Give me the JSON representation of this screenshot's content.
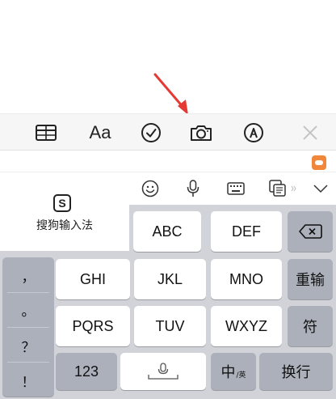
{
  "toolbar": {
    "text_style_label": "Aa",
    "buttons": [
      "table-icon",
      "text-style",
      "checklist-icon",
      "camera-icon",
      "markup-icon",
      "close-icon"
    ]
  },
  "ime": {
    "name": "搜狗输入法",
    "logo_letter": "S",
    "toolbar_icons": [
      "emoji-icon",
      "microphone-icon",
      "keyboard-icon",
      "translate-icon",
      "chevron-down-icon"
    ]
  },
  "keyboard": {
    "punctuation": [
      "，",
      "。",
      "？",
      "！"
    ],
    "rows": [
      [
        "ABC",
        "DEF"
      ],
      [
        "GHI",
        "JKL",
        "MNO"
      ],
      [
        "PQRS",
        "TUV",
        "WXYZ"
      ]
    ],
    "right_keys": {
      "backspace": "backspace-icon",
      "reenter": "重输",
      "symbol": "符",
      "return": "换行"
    },
    "bottom": {
      "numbers": "123",
      "space_mic": "microphone-icon",
      "lang_switch": "中",
      "lang_switch_sub": "/英"
    }
  },
  "colors": {
    "arrow": "#e53a34",
    "sogou_badge": "#f0873a",
    "keyboard_bg": "#d1d3d9",
    "function_key": "#abb0ba"
  }
}
